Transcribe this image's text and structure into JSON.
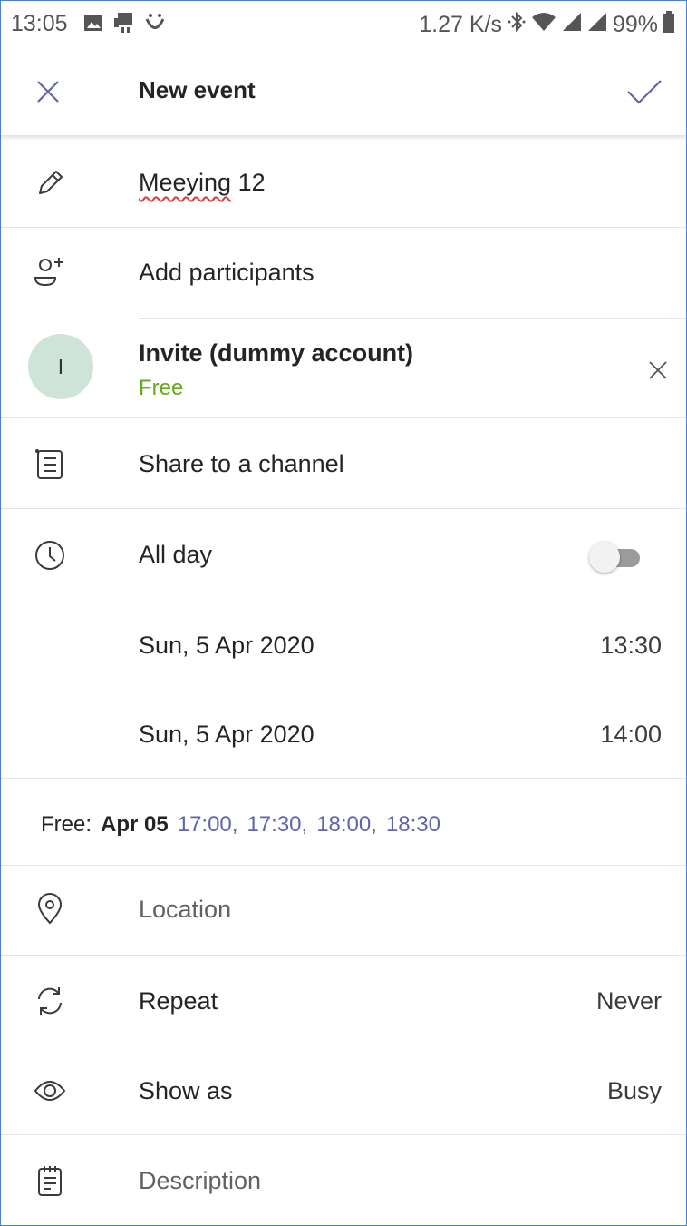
{
  "status_bar": {
    "time": "13:05",
    "net_speed": "1.27 K/s",
    "battery": "99%"
  },
  "app_bar": {
    "title": "New event"
  },
  "form": {
    "title_value": "Meeying",
    "title_suffix": " 12",
    "add_participants": "Add participants",
    "participant": {
      "initial": "I",
      "name": "Invite (dummy account)",
      "availability": "Free"
    },
    "share_channel": "Share to a channel",
    "all_day": {
      "label": "All day",
      "enabled": false
    },
    "start": {
      "date": "Sun, 5 Apr 2020",
      "time": "13:30"
    },
    "end": {
      "date": "Sun, 5 Apr 2020",
      "time": "14:00"
    },
    "suggestions": {
      "label": "Free:",
      "date": "Apr 05",
      "slots": [
        "17:00,",
        "17:30,",
        "18:00,",
        "18:30"
      ]
    },
    "location_placeholder": "Location",
    "repeat": {
      "label": "Repeat",
      "value": "Never"
    },
    "show_as": {
      "label": "Show as",
      "value": "Busy"
    },
    "description_placeholder": "Description"
  },
  "colors": {
    "accent": "#6264a7",
    "available": "#6aa621",
    "avatar_bg": "#cfe4d8",
    "divider": "#e6e6e6"
  }
}
